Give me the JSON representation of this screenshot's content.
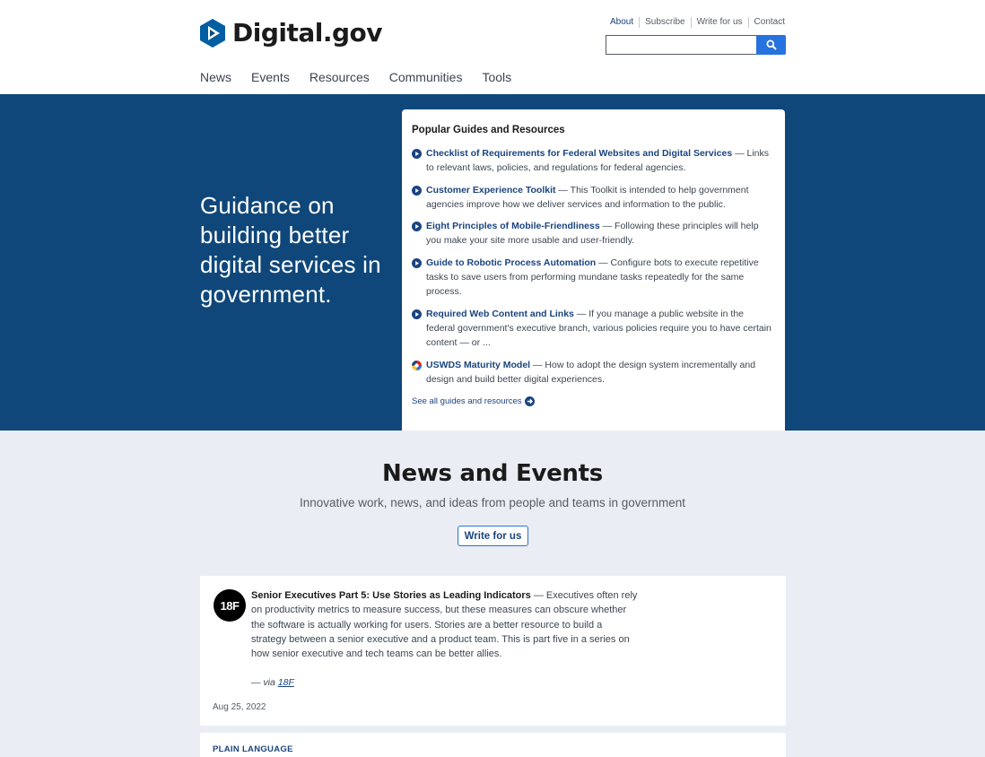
{
  "site": {
    "name": "Digital.gov"
  },
  "utility_nav": [
    "About",
    "Subscribe",
    "Write for us",
    "Contact"
  ],
  "search": {
    "placeholder": ""
  },
  "main_nav": [
    "News",
    "Events",
    "Resources",
    "Communities",
    "Tools"
  ],
  "hero": {
    "heading": "Guidance on building better digital services in government.",
    "guides": {
      "title": "Popular Guides and Resources",
      "items": [
        {
          "title": "Checklist of Requirements for Federal Websites and Digital Services",
          "desc": " — Links to relevant laws, policies, and regulations for federal agencies.",
          "icon": "play-circle-icon"
        },
        {
          "title": "Customer Experience Toolkit",
          "desc": " — This Toolkit is intended to help government agencies improve how we deliver services and information to the public.",
          "icon": "play-circle-icon"
        },
        {
          "title": "Eight Principles of Mobile-Friendliness",
          "desc": " — Following these principles will help you make your site more usable and user-friendly.",
          "icon": "play-circle-icon"
        },
        {
          "title": "Guide to Robotic Process Automation",
          "desc": " — Configure bots to execute repetitive tasks to save users from performing mundane tasks repeatedly for the same process.",
          "icon": "play-circle-icon"
        },
        {
          "title": "Required Web Content and Links",
          "desc": " — If you manage a public website in the federal government's executive branch, various policies require you to have certain content — or ...",
          "icon": "play-circle-icon"
        },
        {
          "title": "USWDS Maturity Model",
          "desc": " — How to adopt the design system incrementally and design and build better digital experiences.",
          "icon": "uswds-logo-icon"
        }
      ],
      "see_all": "See all guides and resources"
    }
  },
  "news": {
    "title": "News and Events",
    "subtitle": "Innovative work, news, and ideas from people and teams in government",
    "write_button": "Write for us",
    "cards": [
      {
        "avatar": "18F",
        "headline": "Senior Executives Part 5: Use Stories as Leading Indicators",
        "summary": " — Executives often rely on productivity metrics to measure success, but these measures can obscure whether the software is actually working for users. Stories are a better resource to build a strategy between a senior executive and a product team. This is part five in a series on how senior executive and tech teams can be better allies.",
        "via_prefix": "— via ",
        "via_source": "18F",
        "date": "Aug 25, 2022"
      },
      {
        "topic": "PLAIN LANGUAGE"
      }
    ]
  },
  "colors": {
    "hero_bg": "#0f477a",
    "link": "#1a4480",
    "accent": "#2672de",
    "section_bg": "#eaeef4"
  }
}
